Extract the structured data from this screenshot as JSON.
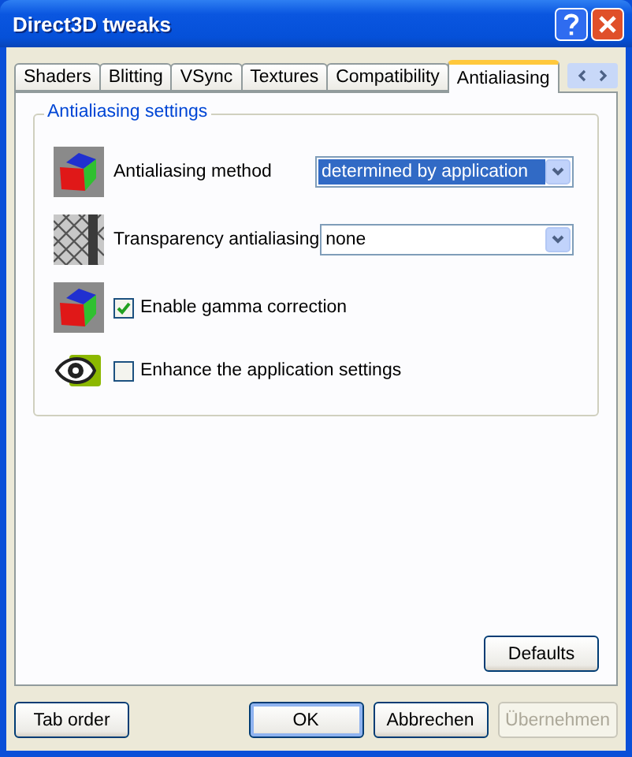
{
  "window": {
    "title": "Direct3D tweaks"
  },
  "tabs": [
    {
      "label": "Shaders",
      "selected": false
    },
    {
      "label": "Blitting",
      "selected": false
    },
    {
      "label": "VSync",
      "selected": false
    },
    {
      "label": "Textures",
      "selected": false
    },
    {
      "label": "Compatibility",
      "selected": false
    },
    {
      "label": "Antialiasing",
      "selected": true
    }
  ],
  "group": {
    "title": "Antialiasing settings",
    "settings": [
      {
        "kind": "dropdown",
        "label": "Antialiasing method",
        "value": "determined by application",
        "highlighted": true
      },
      {
        "kind": "dropdown",
        "label": "Transparency antialiasing",
        "value": "none",
        "highlighted": false
      },
      {
        "kind": "checkbox",
        "label": "Enable gamma correction",
        "checked": true
      },
      {
        "kind": "checkbox",
        "label": "Enhance the application settings",
        "checked": false
      }
    ]
  },
  "panel_buttons": [
    {
      "label": "Defaults",
      "disabled": false,
      "default": false
    }
  ],
  "footer": {
    "left": [
      {
        "label": "Tab order",
        "disabled": false,
        "default": false
      }
    ],
    "right": [
      {
        "label": "OK",
        "disabled": false,
        "default": true
      },
      {
        "label": "Abbrechen",
        "disabled": false,
        "default": false
      },
      {
        "label": "Übernehmen",
        "disabled": true,
        "default": false
      }
    ]
  }
}
